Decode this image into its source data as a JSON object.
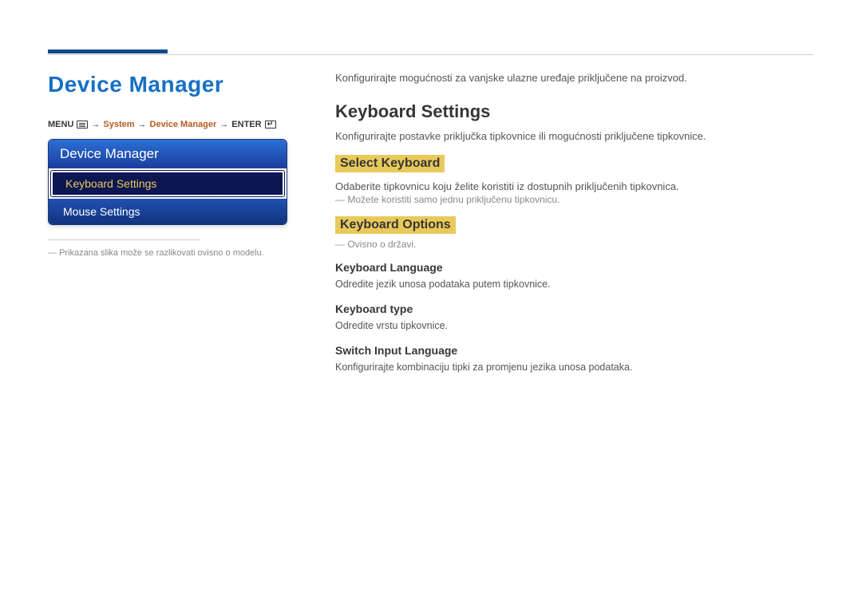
{
  "left": {
    "title": "Device Manager",
    "breadcrumb": {
      "menu": "MENU",
      "arrow": "→",
      "system": "System",
      "devmgr": "Device Manager",
      "enter": "ENTER"
    },
    "panel": {
      "header": "Device Manager",
      "items": [
        {
          "label": "Keyboard Settings",
          "selected": true
        },
        {
          "label": "Mouse Settings",
          "selected": false
        }
      ]
    },
    "footnote": "Prikazana slika može se razlikovati ovisno o modelu."
  },
  "right": {
    "intro": "Konfigurirajte mogućnosti za vanjske ulazne uređaje priključene na proizvod.",
    "h2": "Keyboard Settings",
    "h2_desc": "Konfigurirajte postavke priključka tipkovnice ili mogućnosti priključene tipkovnice.",
    "select_kb": {
      "title": "Select Keyboard",
      "desc": "Odaberite tipkovnicu koju želite koristiti iz dostupnih priključenih tipkovnica.",
      "note": "Možete koristiti samo jednu priključenu tipkovnicu."
    },
    "kb_options": {
      "title": "Keyboard Options",
      "note": "Ovisno o državi.",
      "lang": {
        "title": "Keyboard Language",
        "desc": "Odredite jezik unosa podataka putem tipkovnice."
      },
      "type": {
        "title": "Keyboard type",
        "desc": "Odredite vrstu tipkovnice."
      },
      "switch": {
        "title": "Switch Input Language",
        "desc": "Konfigurirajte kombinaciju tipki za promjenu jezika unosa podataka."
      }
    }
  }
}
